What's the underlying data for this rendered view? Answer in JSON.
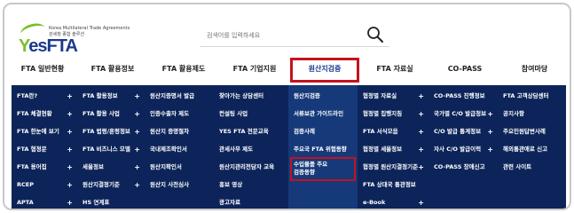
{
  "logo": {
    "tagline_line1": "Korea Multilateral Trade Agreements",
    "tagline_line2": "관세청 종합 솔루션",
    "brand_y": "Y",
    "brand_rest": "esFTA"
  },
  "search": {
    "placeholder": "검색어를 입력하세요"
  },
  "nav": {
    "items": [
      {
        "label": "FTA 일반현황"
      },
      {
        "label": "FTA 활용정보"
      },
      {
        "label": "FTA 활용제도"
      },
      {
        "label": "FTA 기업지원"
      },
      {
        "label": "원산지검증"
      },
      {
        "label": "FTA 자료실"
      },
      {
        "label": "CO-PASS"
      },
      {
        "label": "참여마당"
      }
    ],
    "active": "원산지검증"
  },
  "menu": {
    "columns": [
      [
        "FTA란?",
        "FTA 체결현황",
        "FTA 한눈에 보기",
        "FTA 협정문",
        "FTA 용어집",
        "RCEP",
        "APTA"
      ],
      [
        "FTA 활용정보",
        "FTA 활용 사업",
        "FTA 법령/훈령정보",
        "FTA 비즈니스 모델",
        "세율정보",
        "원산지결정기준",
        "HS 연계표"
      ],
      [
        "원산지증명서 발급",
        "인증수출자 제도",
        "원산지 증명절차",
        "국내제조확인서",
        "원산지확인서",
        "원산지 사전심사",
        ""
      ],
      [
        "찾아가는 상담센터",
        "컨설팅 사업",
        "YES FTA 전문교육",
        "관세사무 제도",
        "원산지관리전담자 교육",
        "홍보 영상",
        "광고자료"
      ],
      [
        "원산지검증",
        "서류보관 가이드라인",
        "검증사례",
        "주요국 FTA 위험동향",
        "수입물품 주요\n검증동향",
        "",
        ""
      ],
      [
        "협정별 자료실",
        "협정별 집행지침",
        "FTA 서식모음",
        "협정별 세율정보",
        "협정별 원산지결정기준",
        "FTA 상대국 통관정보",
        "e-Book"
      ],
      [
        "CO-PASS 진행정보",
        "국가별 C/O 발급정보",
        "C/O 발급 통계정보",
        "자사 C/O 발급이력",
        "CO-PASS 장애신고",
        "",
        ""
      ],
      [
        "FTA 고객상담센터",
        "공지사항",
        "주요민원답변사례",
        "해외통관애로 신고",
        "관련 사이트",
        "",
        ""
      ]
    ]
  },
  "colors": {
    "menu_bg": "#0c2459",
    "highlight_col": "#16397a",
    "highlight_border": "#c4121e",
    "brand_blue": "#1a3a8c",
    "brand_green": "#7bbf2a"
  }
}
